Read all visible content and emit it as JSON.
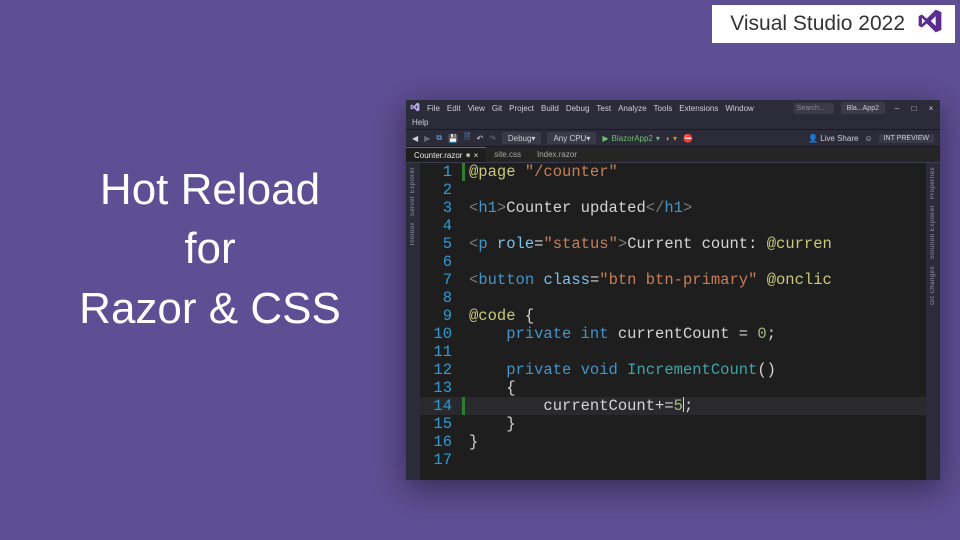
{
  "brand": {
    "label": "Visual Studio 2022"
  },
  "hero": {
    "line1": "Hot Reload",
    "line2": "for",
    "line3": "Razor & CSS"
  },
  "ide": {
    "menubar": {
      "items": [
        "File",
        "Edit",
        "View",
        "Git",
        "Project",
        "Build",
        "Debug",
        "Test",
        "Analyze",
        "Tools",
        "Extensions",
        "Window"
      ],
      "help": "Help",
      "search_placeholder": "Search...",
      "solution_tab": "Bla...App2",
      "window_buttons": {
        "min": "–",
        "max": "□",
        "close": "×"
      }
    },
    "toolbar": {
      "config": "Debug",
      "platform": "Any CPU",
      "run_label": "BlazorApp2",
      "live_share": "Live Share",
      "preview_badge": "INT PREVIEW"
    },
    "tabs": [
      {
        "label": "Counter.razor",
        "active": true
      },
      {
        "label": "site.css",
        "active": false
      },
      {
        "label": "Index.razor",
        "active": false
      }
    ],
    "left_rail": [
      "Server Explorer",
      "Toolbox"
    ],
    "right_rail": [
      "Properties",
      "Solution Explorer",
      "Git Changes"
    ],
    "editor": {
      "highlighted_line": 14,
      "lines": [
        {
          "n": 1,
          "changed": true,
          "tokens": [
            [
              "dir",
              "@page "
            ],
            [
              "str",
              "\"/counter\""
            ]
          ]
        },
        {
          "n": 2,
          "changed": false,
          "tokens": []
        },
        {
          "n": 3,
          "changed": false,
          "tokens": [
            [
              "angle",
              "<"
            ],
            [
              "tag",
              "h1"
            ],
            [
              "angle",
              ">"
            ],
            [
              "plain",
              "Counter updated"
            ],
            [
              "angle",
              "</"
            ],
            [
              "tag",
              "h1"
            ],
            [
              "angle",
              ">"
            ]
          ]
        },
        {
          "n": 4,
          "changed": false,
          "tokens": []
        },
        {
          "n": 5,
          "changed": false,
          "tokens": [
            [
              "angle",
              "<"
            ],
            [
              "tag",
              "p "
            ],
            [
              "attr",
              "role"
            ],
            [
              "plain",
              "="
            ],
            [
              "str",
              "\"status\""
            ],
            [
              "angle",
              ">"
            ],
            [
              "plain",
              "Current count: "
            ],
            [
              "dir",
              "@curren"
            ]
          ]
        },
        {
          "n": 6,
          "changed": false,
          "tokens": []
        },
        {
          "n": 7,
          "changed": false,
          "tokens": [
            [
              "angle",
              "<"
            ],
            [
              "tag",
              "button "
            ],
            [
              "attr",
              "class"
            ],
            [
              "plain",
              "="
            ],
            [
              "str",
              "\"btn btn-primary\" "
            ],
            [
              "dir",
              "@onclic"
            ]
          ]
        },
        {
          "n": 8,
          "changed": false,
          "tokens": []
        },
        {
          "n": 9,
          "changed": false,
          "tokens": [
            [
              "dir",
              "@code "
            ],
            [
              "plain",
              "{"
            ]
          ]
        },
        {
          "n": 10,
          "changed": false,
          "tokens": [
            [
              "plain",
              "    "
            ],
            [
              "kw",
              "private int"
            ],
            [
              "plain",
              " currentCount = "
            ],
            [
              "num",
              "0"
            ],
            [
              "plain",
              ";"
            ]
          ]
        },
        {
          "n": 11,
          "changed": false,
          "tokens": []
        },
        {
          "n": 12,
          "changed": false,
          "tokens": [
            [
              "plain",
              "    "
            ],
            [
              "kw",
              "private void "
            ],
            [
              "type",
              "IncrementCount"
            ],
            [
              "plain",
              "()"
            ]
          ]
        },
        {
          "n": 13,
          "changed": false,
          "tokens": [
            [
              "plain",
              "    {"
            ]
          ]
        },
        {
          "n": 14,
          "changed": true,
          "tokens": [
            [
              "plain",
              "        currentCount+="
            ],
            [
              "num",
              "5"
            ],
            [
              "caret",
              ""
            ],
            [
              "plain",
              ";"
            ]
          ]
        },
        {
          "n": 15,
          "changed": false,
          "tokens": [
            [
              "plain",
              "    }"
            ]
          ]
        },
        {
          "n": 16,
          "changed": false,
          "tokens": [
            [
              "plain",
              "}"
            ]
          ]
        },
        {
          "n": 17,
          "changed": false,
          "tokens": []
        }
      ]
    }
  }
}
